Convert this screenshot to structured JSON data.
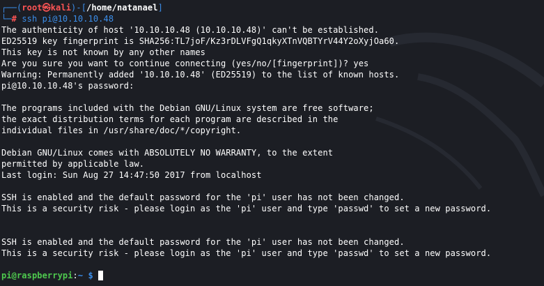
{
  "prompt": {
    "open_bracket": "┌──(",
    "user": "root",
    "at_symbol": "㉿",
    "host": "kali",
    "close_mid": ")-[",
    "path": "/home/natanael",
    "close_bracket": "]",
    "second_prefix": "└─",
    "hash": "#",
    "command": "ssh pi@10.10.10.48"
  },
  "output_lines": [
    "The authenticity of host '10.10.10.48 (10.10.10.48)' can't be established.",
    "ED25519 key fingerprint is SHA256:TL7joF/Kz3rDLVFgQ1qkyXTnVQBTYrV44Y2oXyjOa60.",
    "This key is not known by any other names",
    "Are you sure you want to continue connecting (yes/no/[fingerprint])? yes",
    "Warning: Permanently added '10.10.10.48' (ED25519) to the list of known hosts.",
    "pi@10.10.10.48's password:",
    "",
    "The programs included with the Debian GNU/Linux system are free software;",
    "the exact distribution terms for each program are described in the",
    "individual files in /usr/share/doc/*/copyright.",
    "",
    "Debian GNU/Linux comes with ABSOLUTELY NO WARRANTY, to the extent",
    "permitted by applicable law.",
    "Last login: Sun Aug 27 14:47:50 2017 from localhost",
    "",
    "SSH is enabled and the default password for the 'pi' user has not been changed.",
    "This is a security risk - please login as the 'pi' user and type 'passwd' to set a new password.",
    "",
    "",
    "SSH is enabled and the default password for the 'pi' user has not been changed.",
    "This is a security risk - please login as the 'pi' user and type 'passwd' to set a new password.",
    ""
  ],
  "remote_prompt": {
    "user_host": "pi@raspberrypi",
    "colon": ":",
    "path": "~",
    "dollar": "$"
  },
  "colors": {
    "background": "#1c1e24",
    "prompt_frame": "#3b8eea",
    "prompt_user": "#ff5555",
    "remote_user": "#4ec94e"
  }
}
